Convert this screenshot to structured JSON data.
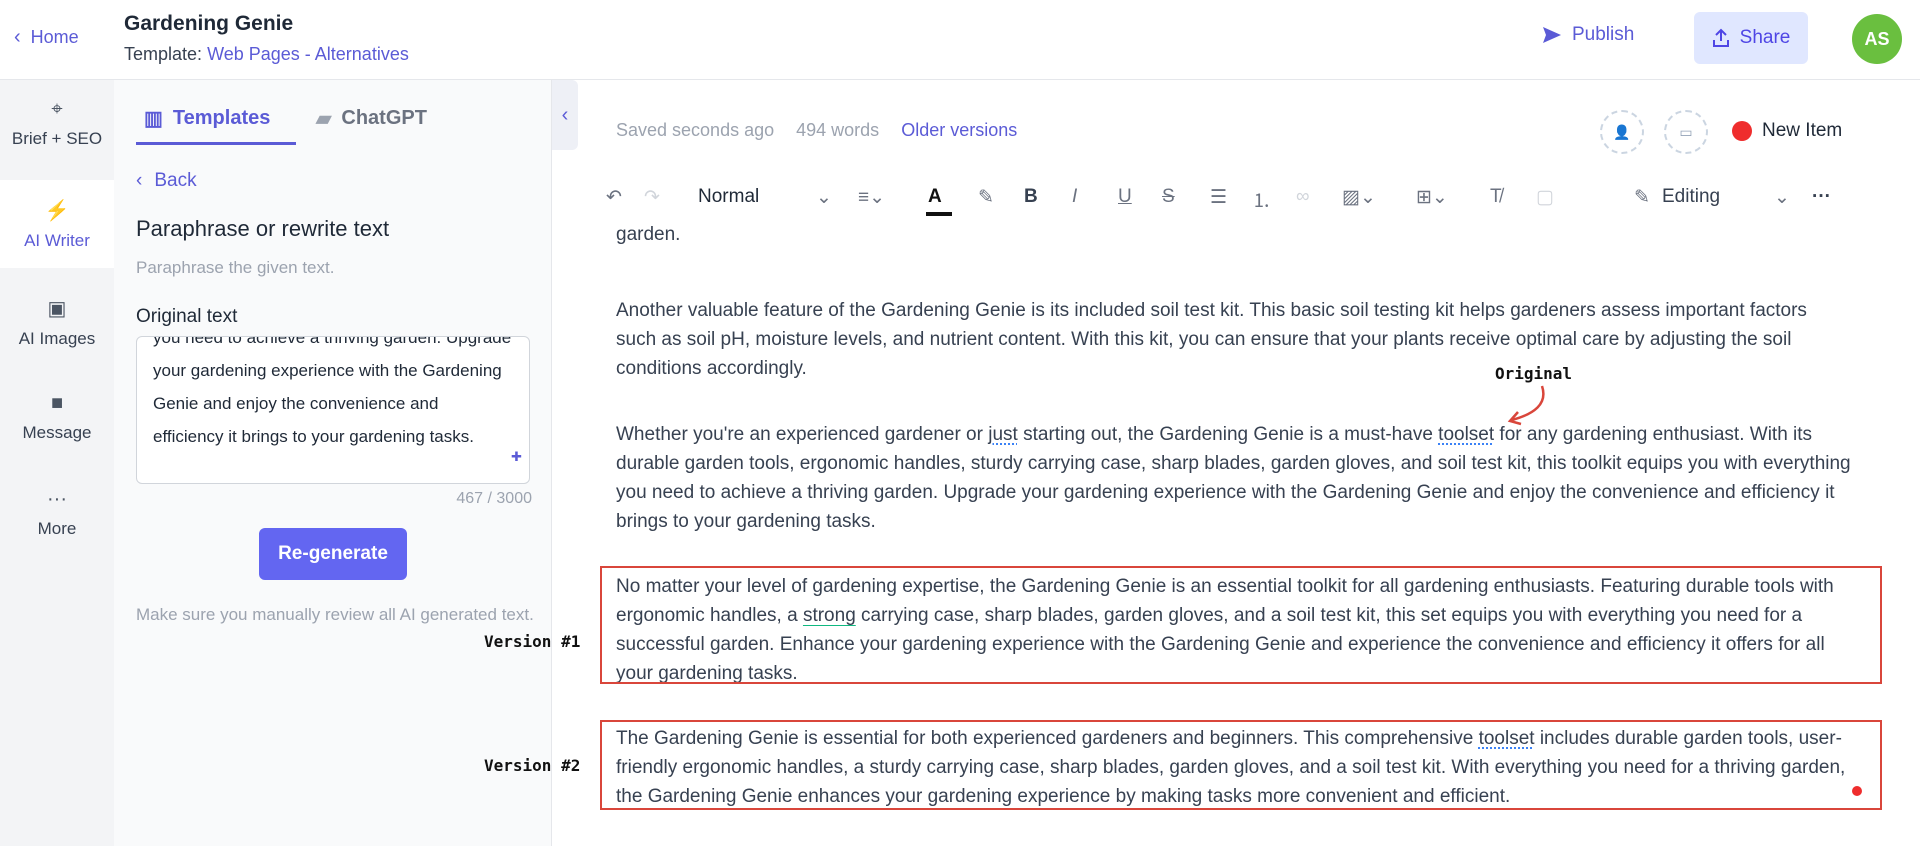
{
  "header": {
    "home_label": "Home",
    "doc_title": "Gardening Genie",
    "template_prefix": "Template:",
    "template_link": "Web Pages - Alternatives",
    "publish_label": "Publish",
    "share_label": "Share",
    "avatar_initials": "AS"
  },
  "rail": {
    "items": [
      {
        "label": "Brief + SEO",
        "icon": "crosshair-icon"
      },
      {
        "label": "AI Writer",
        "icon": "lightning-icon"
      },
      {
        "label": "AI Images",
        "icon": "image-icon"
      },
      {
        "label": "Message",
        "icon": "chat-icon"
      },
      {
        "label": "More",
        "icon": "ellipsis-icon"
      }
    ]
  },
  "panel": {
    "tabs": [
      {
        "label": "Templates",
        "icon": "templates-icon"
      },
      {
        "label": "ChatGPT",
        "icon": "chat-bubbles-icon"
      }
    ],
    "back_label": "Back",
    "tool_title": "Paraphrase or rewrite text",
    "tool_desc": "Paraphrase the given text.",
    "original_label": "Original text",
    "original_text": "you need to achieve a thriving garden. Upgrade your gardening experience with the Gardening Genie and enjoy the convenience and efficiency it brings to your gardening tasks.",
    "counter": "467 / 3000",
    "regen_label": "Re-generate",
    "note": "Make sure you manually review all AI generated text."
  },
  "editor": {
    "saved": "Saved seconds ago",
    "words": "494 words",
    "older_versions": "Older versions",
    "new_item": "New Item",
    "style_select": "Normal",
    "mode": "Editing",
    "accent_color": "#5b5bd6",
    "annotation_color": "#d9463b"
  },
  "doc": {
    "p0": "garden.",
    "p1": "Another valuable feature of the Gardening Genie is its included soil test kit. This basic soil testing kit helps gardeners assess important factors such as soil pH, moisture levels, and nutrient content. With this kit, you can ensure that your plants receive optimal care by adjusting the soil conditions accordingly.",
    "p2_a": "Whether you're an experienced gardener or ",
    "p2_just": "just",
    "p2_b": " starting out, the Gardening Genie is a must-have ",
    "p2_toolset": "toolset",
    "p2_c": " for any gardening enthusiast. With its durable garden tools, ergonomic handles, sturdy carrying case, sharp blades, garden gloves, and soil test kit, this toolkit equips you with everything you need to achieve a thriving garden. Upgrade your gardening experience with the Gardening Genie and enjoy the convenience and efficiency it brings to your gardening tasks.",
    "v1_a": "No matter your level of gardening expertise, the Gardening Genie is an essential toolkit for all gardening enthusiasts. Featuring durable tools with ergonomic handles, a ",
    "v1_strong": "strong",
    "v1_b": " carrying case, sharp blades, garden gloves, and a soil test kit, this set equips you with everything you need for a successful garden. Enhance your gardening experience with the Gardening Genie and experience the convenience and efficiency it offers for all your gardening tasks.",
    "v2_a": "The Gardening Genie is essential for both experienced gardeners and beginners. This comprehensive ",
    "v2_toolset": "toolset",
    "v2_b": " includes durable garden tools, user-friendly ergonomic handles, a sturdy carrying case, sharp blades, garden gloves, and a soil test kit. With everything you need for a thriving garden, the Gardening Genie enhances your gardening experience by making tasks more convenient and efficient."
  },
  "annotations": {
    "original": "Original",
    "version1": "Version #1",
    "version2": "Version #2"
  }
}
